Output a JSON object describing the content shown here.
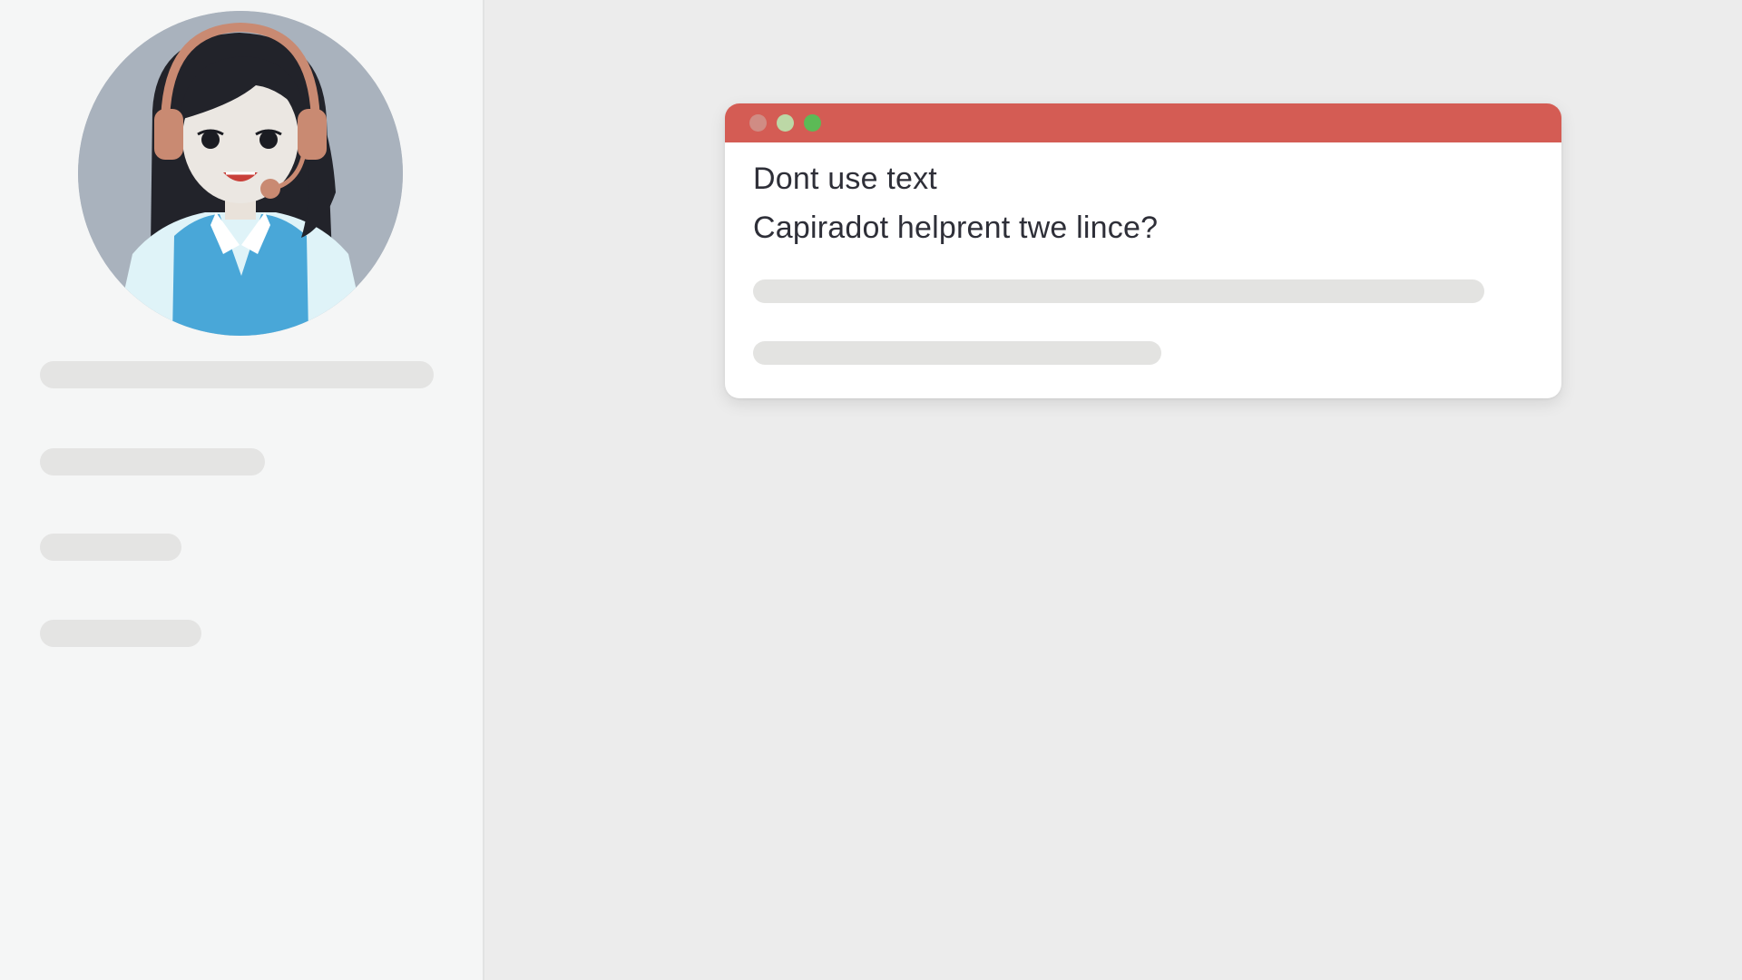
{
  "dialog": {
    "line1": "Dont use text",
    "line2": "Capiradot helprent twe lince?",
    "titlebar_color": "#d45c54",
    "buttons": [
      "close-dot",
      "minimize-dot",
      "maximize-dot"
    ]
  },
  "sidebar": {
    "avatar_icon": "support-agent-headset-avatar"
  },
  "colors": {
    "background": "#ececec",
    "sidebar": "#f5f6f6",
    "placeholder": "#e4e4e3"
  }
}
